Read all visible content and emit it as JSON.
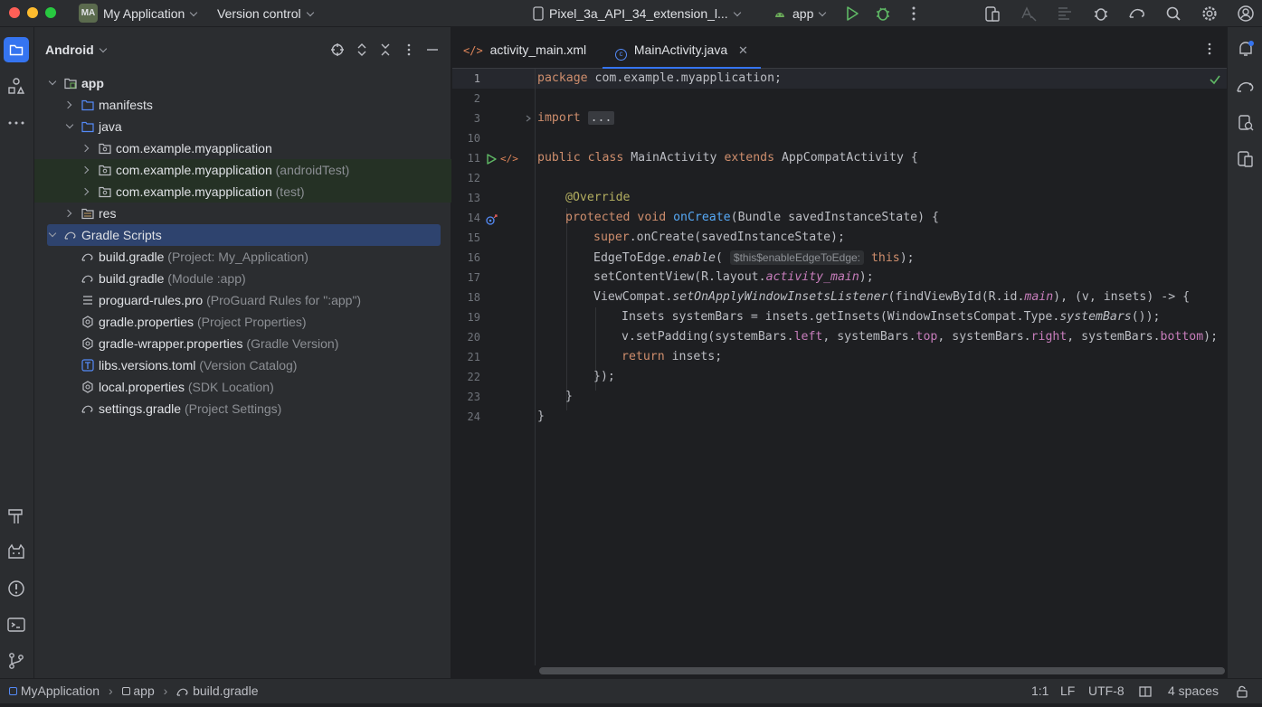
{
  "titlebar": {
    "project_badge": "MA",
    "project_name": "My Application",
    "vcs": "Version control",
    "device": "Pixel_3a_API_34_extension_l...",
    "run_config": "app",
    "icons": [
      "run-icon",
      "debug-icon",
      "more-icon",
      "device-manager-icon",
      "translate-icon",
      "layout-inspector-icon",
      "bug-icon",
      "gradle-sync-icon",
      "search-icon",
      "settings-icon",
      "account-icon"
    ]
  },
  "project_panel": {
    "title": "Android",
    "tree": [
      {
        "label": "app",
        "hint": ""
      },
      {
        "label": "manifests",
        "hint": ""
      },
      {
        "label": "java",
        "hint": ""
      },
      {
        "label": "com.example.myapplication",
        "hint": ""
      },
      {
        "label": "com.example.myapplication",
        "hint": "(androidTest)"
      },
      {
        "label": "com.example.myapplication",
        "hint": "(test)"
      },
      {
        "label": "res",
        "hint": ""
      },
      {
        "label": "Gradle Scripts",
        "hint": ""
      },
      {
        "label": "build.gradle",
        "hint": "(Project: My_Application)"
      },
      {
        "label": "build.gradle",
        "hint": "(Module :app)"
      },
      {
        "label": "proguard-rules.pro",
        "hint": "(ProGuard Rules for \":app\")"
      },
      {
        "label": "gradle.properties",
        "hint": "(Project Properties)"
      },
      {
        "label": "gradle-wrapper.properties",
        "hint": "(Gradle Version)"
      },
      {
        "label": "libs.versions.toml",
        "hint": "(Version Catalog)"
      },
      {
        "label": "local.properties",
        "hint": "(SDK Location)"
      },
      {
        "label": "settings.gradle",
        "hint": "(Project Settings)"
      }
    ]
  },
  "editor": {
    "tabs": [
      {
        "label": "activity_main.xml"
      },
      {
        "label": "MainActivity.java"
      }
    ],
    "line_numbers": [
      "1",
      "2",
      "3",
      "10",
      "11",
      "12",
      "13",
      "14",
      "15",
      "16",
      "17",
      "18",
      "19",
      "20",
      "21",
      "22",
      "23",
      "24"
    ],
    "code": {
      "l1_kw": "package",
      "l1_rest": " com.example.myapplication;",
      "l3_kw": "import",
      "l3_fold": "...",
      "l11_kw1": "public class",
      "l11_cls": " MainActivity ",
      "l11_kw2": "extends",
      "l11_rest": " AppCompatActivity {",
      "l13_an": "@Override",
      "l14_kw": "protected void",
      "l14_fn": "onCreate",
      "l14_rest": "(Bundle savedInstanceState) {",
      "l15_kw": "super",
      "l15_rest": ".onCreate(savedInstanceState);",
      "l16_a": "EdgeToEdge.",
      "l16_it": "enable",
      "l16_b": "(",
      "l16_inlay": "$this$enableEdgeToEdge:",
      "l16_kw": "this",
      "l16_c": ");",
      "l17_a": "setContentView(R.layout.",
      "l17_pu": "activity_main",
      "l17_b": ");",
      "l18_a": "ViewCompat.",
      "l18_it": "setOnApplyWindowInsetsListener",
      "l18_b": "(findViewById(R.id.",
      "l18_pu": "main",
      "l18_c": "), (v, insets) -> {",
      "l19_a": "Insets systemBars = insets.getInsets(WindowInsetsCompat.Type.",
      "l19_it": "systemBars",
      "l19_b": "());",
      "l20_a": "v.setPadding(systemBars.",
      "l20_p1": "left",
      "l20_b": ", systemBars.",
      "l20_p2": "top",
      "l20_c": ", systemBars.",
      "l20_p3": "right",
      "l20_d": ", systemBars.",
      "l20_p4": "bottom",
      "l20_e": ");",
      "l21_kw": "return",
      "l21_rest": " insets;",
      "l22": "});",
      "l23": "}",
      "l24": "}"
    }
  },
  "statusbar": {
    "breadcrumb": [
      "MyApplication",
      "app",
      "build.gradle"
    ],
    "position": "1:1",
    "line_sep": "LF",
    "encoding": "UTF-8",
    "indent": "4 spaces"
  },
  "colors": {
    "accent": "#3574f0",
    "keyword": "#cf8e6d",
    "function": "#56a8f5",
    "annotation": "#b3ae60",
    "property": "#c77dbb",
    "selection": "#2e436e"
  }
}
